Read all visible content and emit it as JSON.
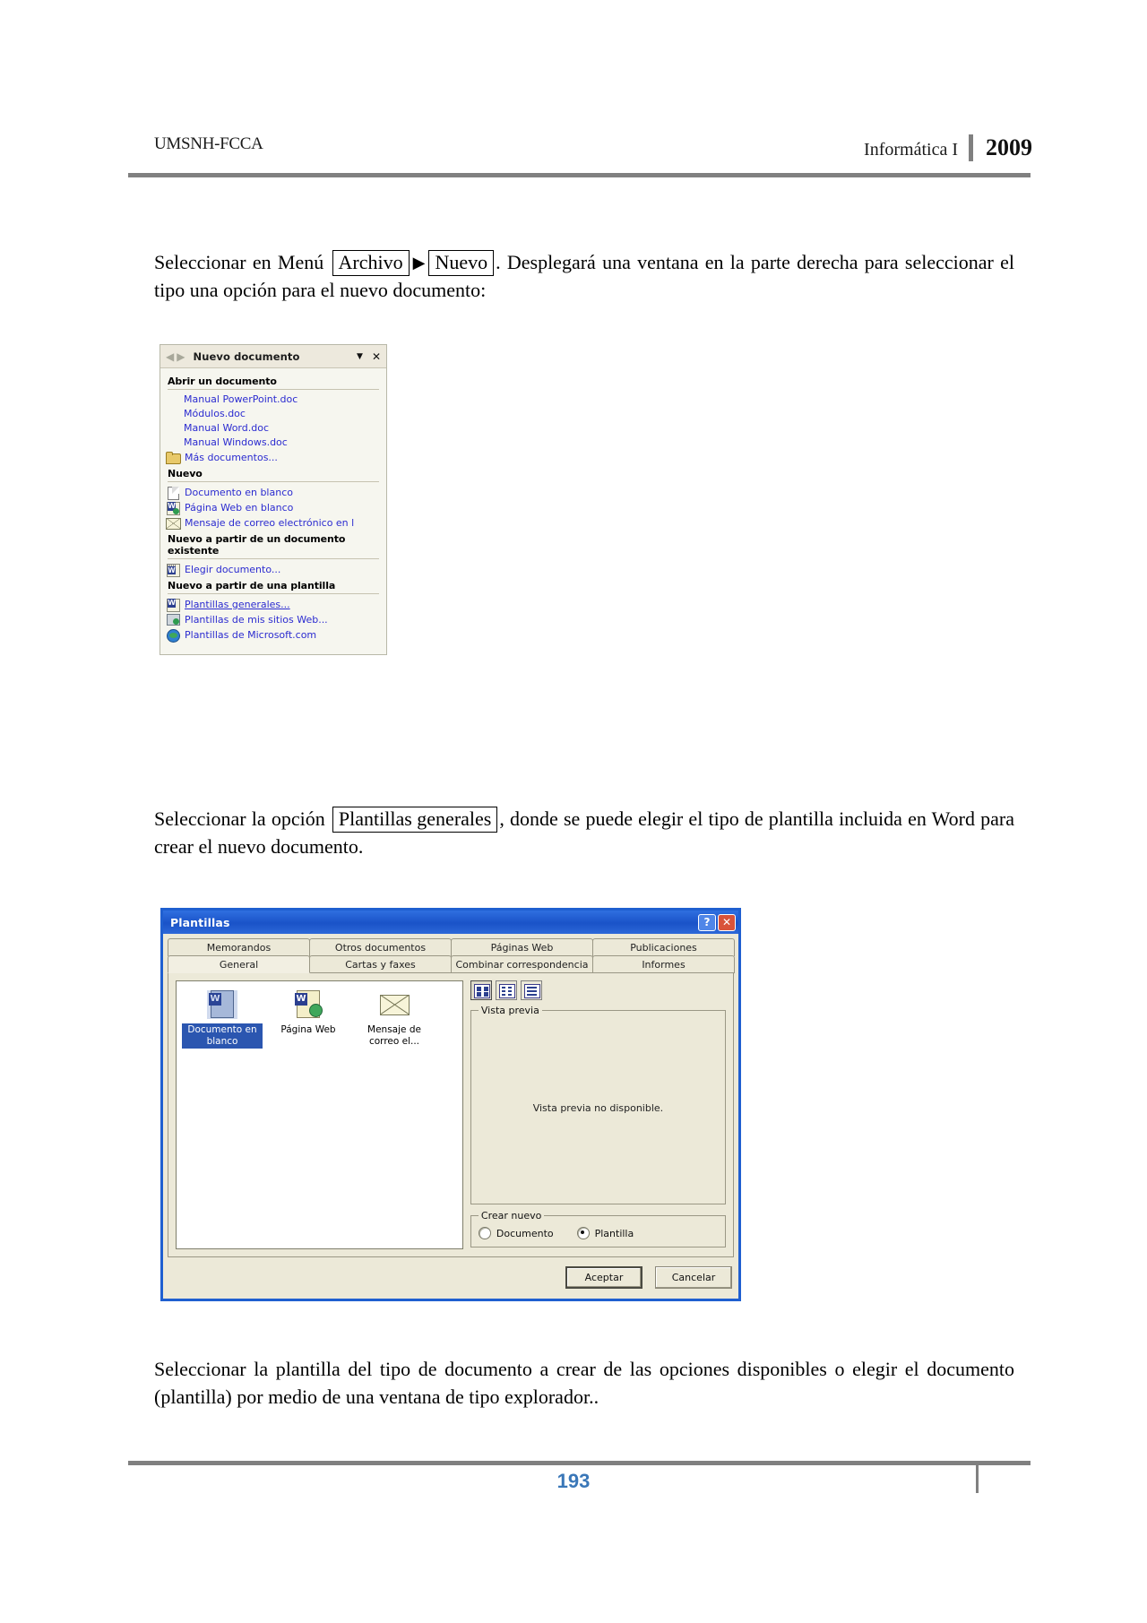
{
  "header": {
    "left": "UMSNH-FCCA",
    "course": "Informática I",
    "year": "2009"
  },
  "paragraphs": {
    "p1_a": "Seleccionar en Menú",
    "p1_box1": "Archivo",
    "p1_arrow": "▶",
    "p1_box2": "Nuevo",
    "p1_b": ". Desplegará una ventana en la parte derecha para seleccionar el tipo una opción para el nuevo documento:",
    "p2_a": "Seleccionar la opción",
    "p2_box": "Plantillas generales",
    "p2_b": ", donde se puede elegir el tipo de plantilla incluida en Word para crear el nuevo documento.",
    "p3": "Seleccionar la plantilla del tipo de documento a crear de las opciones disponibles o elegir el documento (plantilla) por medio de una ventana de tipo explorador.."
  },
  "taskpane": {
    "title": "Nuevo documento",
    "back_icon": "back-arrow-icon",
    "forward_icon": "forward-arrow-icon",
    "caret": "▼",
    "close": "✕",
    "sections": [
      {
        "heading": "Abrir un documento",
        "items": [
          {
            "label": "Manual PowerPoint.doc",
            "icon": "none"
          },
          {
            "label": "Módulos.doc",
            "icon": "none"
          },
          {
            "label": "Manual Word.doc",
            "icon": "none"
          },
          {
            "label": "Manual Windows.doc",
            "icon": "none"
          },
          {
            "label": "Más documentos...",
            "icon": "folder-icon"
          }
        ]
      },
      {
        "heading": "Nuevo",
        "items": [
          {
            "label": "Documento en blanco",
            "icon": "blank-document-icon"
          },
          {
            "label": "Página Web en blanco",
            "icon": "web-page-icon"
          },
          {
            "label": "Mensaje de correo electrónico en l",
            "icon": "mail-icon"
          }
        ]
      },
      {
        "heading": "Nuevo a partir de un documento existente",
        "items": [
          {
            "label": "Elegir documento...",
            "icon": "choose-document-icon"
          }
        ]
      },
      {
        "heading": "Nuevo a partir de una plantilla",
        "items": [
          {
            "label": "Plantillas generales...",
            "icon": "word-template-icon",
            "hover": true
          },
          {
            "label": "Plantillas de mis sitios Web...",
            "icon": "monitor-web-icon"
          },
          {
            "label": "Plantillas de Microsoft.com",
            "icon": "globe-icon"
          }
        ]
      }
    ]
  },
  "dialog": {
    "title": "Plantillas",
    "help_button": "?",
    "close_button": "✕",
    "tabs_row1": [
      "Memorandos",
      "Otros documentos",
      "Páginas Web",
      "Publicaciones"
    ],
    "tabs_row2": [
      "General",
      "Cartas y faxes",
      "Combinar correspondencia",
      "Informes"
    ],
    "active_tab": "General",
    "templates": [
      {
        "label": "Documento en blanco",
        "icon": "word-document-icon",
        "selected": true
      },
      {
        "label": "Página Web",
        "icon": "web-page-icon",
        "selected": false
      },
      {
        "label": "Mensaje de correo el...",
        "icon": "mail-icon",
        "selected": false
      }
    ],
    "view_buttons": [
      {
        "name": "large-icons-view-button",
        "active": true
      },
      {
        "name": "list-view-button",
        "active": false
      },
      {
        "name": "details-view-button",
        "active": false
      }
    ],
    "preview_legend": "Vista previa",
    "preview_text": "Vista previa no disponible.",
    "create_legend": "Crear nuevo",
    "radio_document": "Documento",
    "radio_template": "Plantilla",
    "radio_selected": "Plantilla",
    "ok_button": "Aceptar",
    "cancel_button": "Cancelar"
  },
  "footer": {
    "page_number": "193"
  },
  "colors": {
    "rule": "#808080",
    "page_number": "#3a77b8",
    "dialog_border": "#1f5fd0",
    "link": "#2b2bd0",
    "selection": "#2b56b0"
  }
}
